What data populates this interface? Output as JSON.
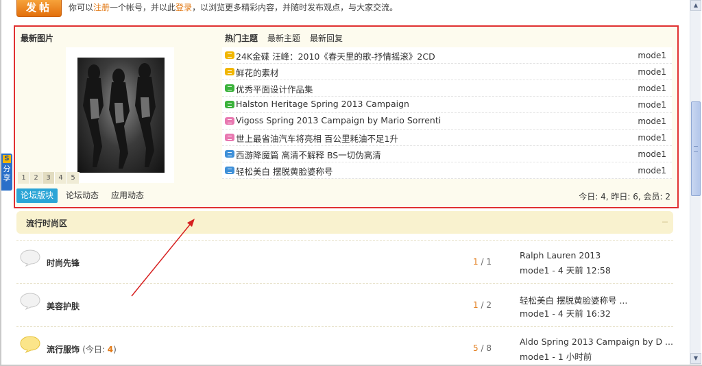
{
  "header": {
    "post_button": "发帖",
    "welcome": {
      "before": "你可以",
      "register_link": "注册",
      "middle": "一个帐号，并以此",
      "login_link": "登录",
      "after": "，以浏览更多精彩内容，并随时发布观点，与大家交流。"
    }
  },
  "share": {
    "logo": "S",
    "label": "分享"
  },
  "gallery": {
    "title": "最新图片",
    "pages": [
      "1",
      "2",
      "3",
      "4",
      "5"
    ],
    "active_page": 3
  },
  "topics": {
    "tabs": [
      "热门主题",
      "最新主题",
      "最新回复"
    ],
    "items": [
      {
        "title": "24K金碟 汪峰：2010《春天里的歌-抒情摇滚》2CD",
        "author": "mode1",
        "icon": "hot-topic-icon",
        "color": "#f1b600"
      },
      {
        "title": "鲜花的素材",
        "author": "mode1",
        "icon": "topic-icon",
        "color": "#f1b600"
      },
      {
        "title": "优秀平面设计作品集",
        "author": "mode1",
        "icon": "topic-icon",
        "color": "#3bb23b"
      },
      {
        "title": "Halston Heritage Spring 2013 Campaign",
        "author": "mode1",
        "icon": "topic-icon",
        "color": "#3bb23b"
      },
      {
        "title": "Vigoss Spring 2013 Campaign by Mario Sorrenti",
        "author": "mode1",
        "icon": "topic-icon",
        "color": "#e878b0"
      },
      {
        "title": "世上最省油汽车将亮相 百公里耗油不足1升",
        "author": "mode1",
        "icon": "topic-icon",
        "color": "#e878b0"
      },
      {
        "title": "西游降魔篇 高清不解释 BS一切伪高清",
        "author": "mode1",
        "icon": "topic-icon",
        "color": "#3f90d8"
      },
      {
        "title": "轻松美白 摆脱黄脸婆称号",
        "author": "mode1",
        "icon": "topic-icon",
        "color": "#3f90d8"
      }
    ]
  },
  "bottom_tabs": [
    "论坛版块",
    "论坛动态",
    "应用动态"
  ],
  "stats": "今日: 4, 昨日: 6, 会员: 2",
  "section": {
    "title": "流行时尚区",
    "forums": [
      {
        "name": "时尚先锋",
        "today_label": "",
        "today_count": "",
        "topics": "1",
        "posts": "1",
        "last_title": "Ralph Lauren 2013",
        "last_meta": "mode1 - 4 天前 12:58",
        "active": false
      },
      {
        "name": "美容护肤",
        "today_label": "",
        "today_count": "",
        "topics": "1",
        "posts": "2",
        "last_title": "轻松美白 摆脱黄脸婆称号 ...",
        "last_meta": "mode1 - 4 天前 16:32",
        "active": false
      },
      {
        "name": "流行服饰",
        "today_label": "(今日: ",
        "today_count": "4",
        "today_close": ")",
        "topics": "5",
        "posts": "8",
        "last_title": "Aldo Spring 2013 Campaign by D ...",
        "last_meta": "mode1 - 1 小时前",
        "active": true
      }
    ]
  }
}
